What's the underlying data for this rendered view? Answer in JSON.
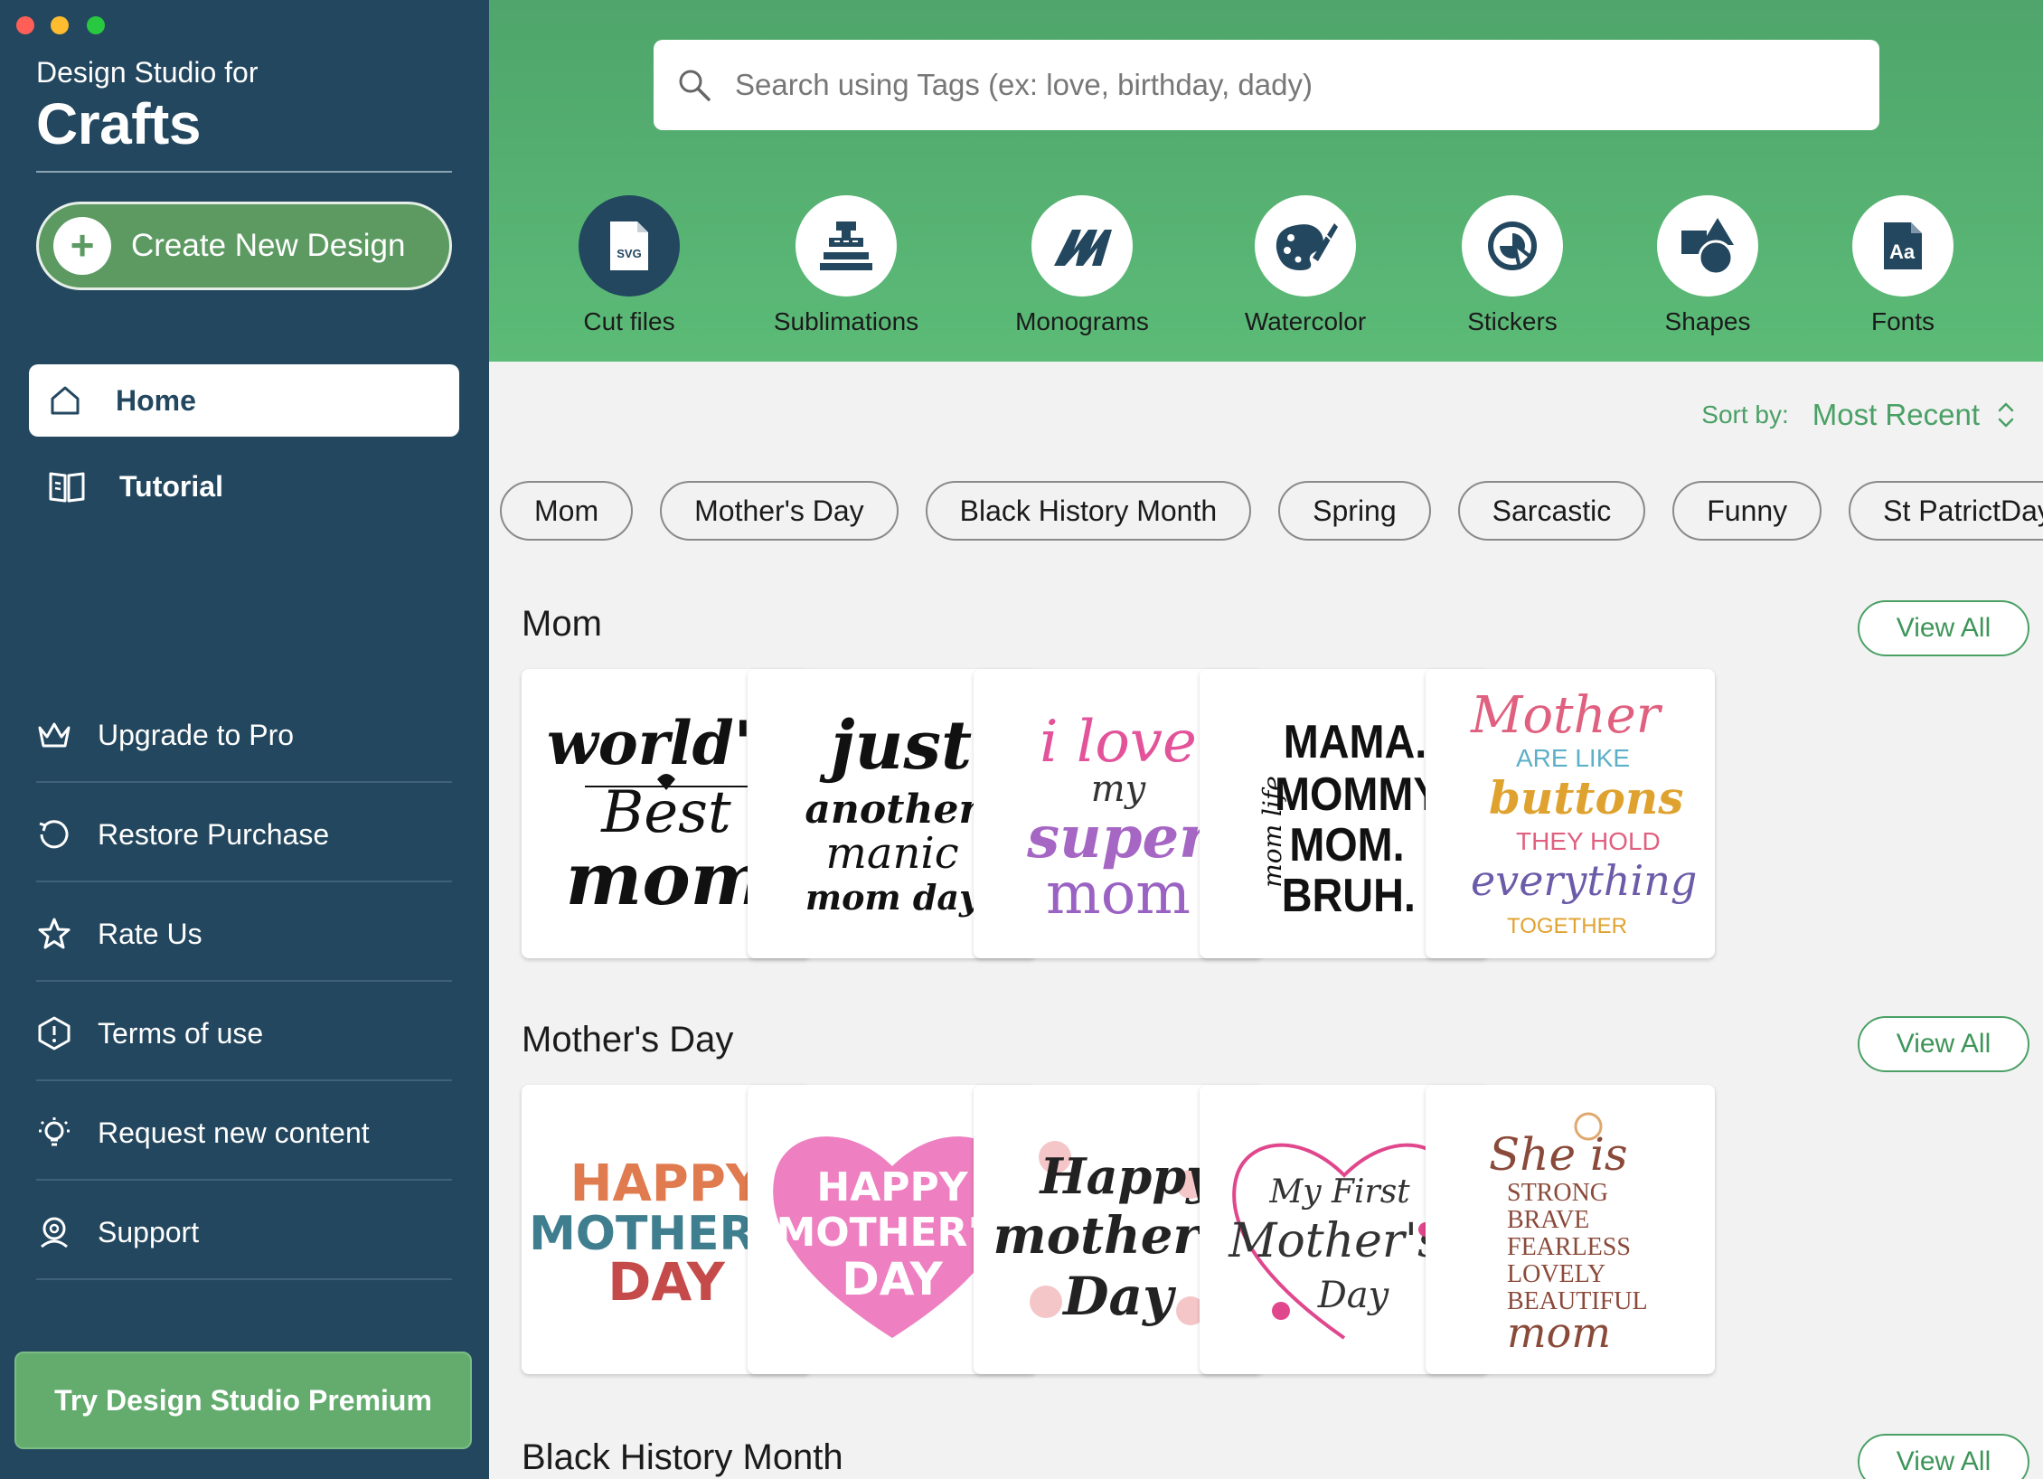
{
  "window": {
    "traffic_lights": [
      "#ff5f57",
      "#febc2e",
      "#28c840"
    ]
  },
  "sidebar": {
    "brand_sub": "Design Studio for",
    "brand_title": "Crafts",
    "create_label": "Create New Design",
    "nav": [
      {
        "label": "Home",
        "icon": "home-icon",
        "active": true
      },
      {
        "label": "Tutorial",
        "icon": "book-icon",
        "active": false
      }
    ],
    "menu": [
      {
        "label": "Upgrade to Pro",
        "icon": "crown-icon"
      },
      {
        "label": "Restore Purchase",
        "icon": "restore-icon"
      },
      {
        "label": "Rate Us",
        "icon": "star-icon"
      },
      {
        "label": "Terms of use",
        "icon": "info-icon"
      },
      {
        "label": "Request new content",
        "icon": "lightbulb-icon"
      },
      {
        "label": "Support",
        "icon": "support-icon"
      }
    ],
    "premium_label": "Try Design Studio Premium"
  },
  "header": {
    "search_placeholder": "Search using Tags (ex: love, birthday, dady)",
    "categories": [
      {
        "label": "Cut files",
        "icon": "svg-file-icon"
      },
      {
        "label": "Sublimations",
        "icon": "heat-press-icon"
      },
      {
        "label": "Monograms",
        "icon": "monogram-icon"
      },
      {
        "label": "Watercolor",
        "icon": "palette-icon"
      },
      {
        "label": "Stickers",
        "icon": "sticker-icon"
      },
      {
        "label": "Shapes",
        "icon": "shapes-icon"
      },
      {
        "label": "Fonts",
        "icon": "font-icon"
      }
    ]
  },
  "content": {
    "sort_label": "Sort by:",
    "sort_value": "Most Recent",
    "chips": [
      "Mom",
      "Mother's Day",
      "Black History Month",
      "Spring",
      "Sarcastic",
      "Funny",
      "St PatrictDay"
    ],
    "view_all": "View All",
    "sections": [
      {
        "title": "Mom",
        "cards": [
          {
            "lines": [
              "world's",
              "Best",
              "mom"
            ],
            "premium": false
          },
          {
            "lines": [
              "just",
              "another",
              "manic",
              "mom day"
            ],
            "premium": false
          },
          {
            "lines": [
              "i love",
              "my",
              "super",
              "mom"
            ],
            "premium": false
          },
          {
            "lines": [
              "MAMA.",
              "MOMMY.",
              "MOM.",
              "BRUH.",
              "mom life"
            ],
            "premium": true
          },
          {
            "lines": [
              "Mother",
              "ARE LIKE",
              "buttons",
              "THEY HOLD",
              "everything",
              "TOGETHER"
            ],
            "premium": false
          }
        ]
      },
      {
        "title": "Mother's Day",
        "cards": [
          {
            "lines": [
              "HAPPY",
              "MOTHER'S",
              "DAY"
            ],
            "premium": false
          },
          {
            "lines": [
              "HAPPY",
              "MOTHER'S",
              "DAY"
            ],
            "premium": false
          },
          {
            "lines": [
              "Happy",
              "mother's",
              "Day"
            ],
            "premium": false
          },
          {
            "lines": [
              "My First",
              "Mother's",
              "Day"
            ],
            "premium": true
          },
          {
            "lines": [
              "She is",
              "STRONG",
              "BRAVE",
              "FEARLESS",
              "LOVELY",
              "BEAUTIFUL",
              "mom"
            ],
            "premium": false
          }
        ]
      },
      {
        "title": "Black History Month",
        "cards": []
      }
    ]
  },
  "colors": {
    "sidebar": "#23475f",
    "accent": "#4aa065",
    "header": "#5cbb77",
    "crown": "#f2b700"
  }
}
